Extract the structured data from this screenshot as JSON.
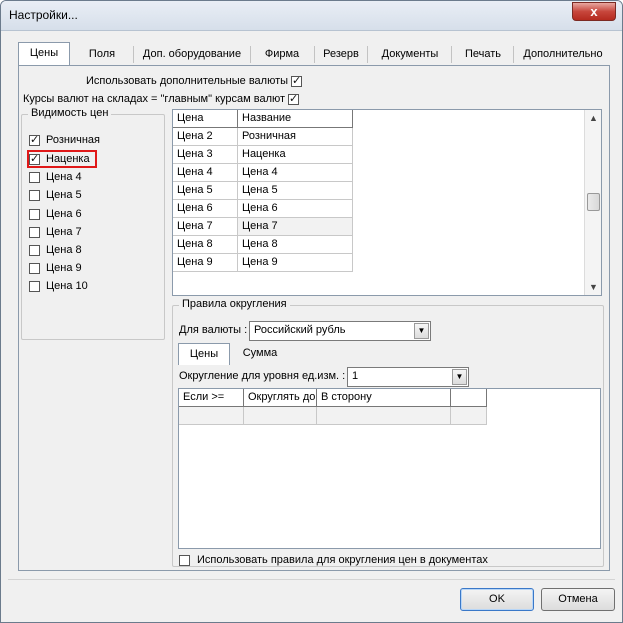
{
  "window": {
    "title": "Настройки...",
    "close_glyph": "x"
  },
  "tabs": [
    {
      "label": "Цены",
      "active": true
    },
    {
      "label": "Поля"
    },
    {
      "label": "Доп. оборудование"
    },
    {
      "label": "Фирма"
    },
    {
      "label": "Резерв"
    },
    {
      "label": "Документы"
    },
    {
      "label": "Печать"
    },
    {
      "label": "Дополнительно"
    }
  ],
  "options": {
    "extra_currencies_label": "Использовать дополнительные валюты",
    "extra_currencies_checked": true,
    "warehouse_rates_label": "Курсы валют на складах = \"главным\" курсам валют",
    "warehouse_rates_checked": true
  },
  "visibility": {
    "title": "Видимость цен",
    "items": [
      {
        "label": "Розничная",
        "checked": true
      },
      {
        "label": "Наценка",
        "checked": true,
        "highlighted": true
      },
      {
        "label": "Цена 4",
        "checked": false
      },
      {
        "label": "Цена 5",
        "checked": false
      },
      {
        "label": "Цена 6",
        "checked": false
      },
      {
        "label": "Цена 7",
        "checked": false
      },
      {
        "label": "Цена 8",
        "checked": false
      },
      {
        "label": "Цена 9",
        "checked": false
      },
      {
        "label": "Цена 10",
        "checked": false
      }
    ]
  },
  "price_table": {
    "headers": [
      "Цена",
      "Название"
    ],
    "rows": [
      [
        "Цена 2",
        "Розничная"
      ],
      [
        "Цена 3",
        "Наценка"
      ],
      [
        "Цена 4",
        "Цена 4"
      ],
      [
        "Цена 5",
        "Цена 5"
      ],
      [
        "Цена 6",
        "Цена 6"
      ],
      [
        "Цена 7",
        "Цена 7"
      ],
      [
        "Цена 8",
        "Цена 8"
      ],
      [
        "Цена 9",
        "Цена 9"
      ]
    ],
    "scroll_up": "▲",
    "scroll_down": "▼"
  },
  "rounding": {
    "title": "Правила округления",
    "currency_label": "Для валюты :",
    "currency_value": "Российский рубль",
    "subtabs": [
      {
        "label": "Цены",
        "active": true
      },
      {
        "label": "Сумма"
      }
    ],
    "level_label": "Округление для уровня ед.изм. :",
    "level_value": "1",
    "table_headers": [
      "Если >=",
      "Округлять до",
      "В сторону",
      ""
    ],
    "use_in_docs_label": "Использовать правила для округления цен в документах",
    "use_in_docs_checked": false,
    "dropdown_glyph": "▼"
  },
  "buttons": {
    "ok": "OK",
    "cancel": "Отмена"
  }
}
